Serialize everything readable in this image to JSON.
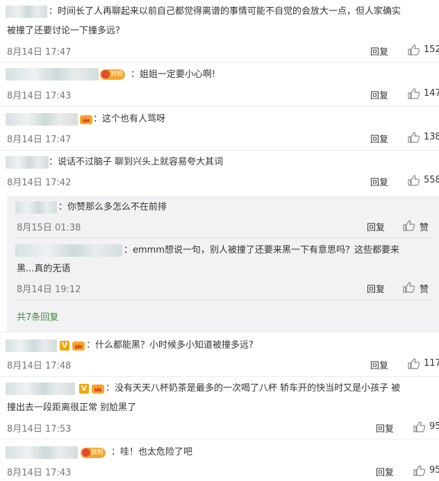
{
  "comments": [
    {
      "text": "：时间长了人再聊起来以前自己都觉得离谱的事情可能不自觉的会放大一点，但人家确实",
      "text2": "被撞了还要讨论一下撞多远?",
      "time": "8月14日 17:47",
      "reply": "回复",
      "likes": "152"
    },
    {
      "text": "：姐姐一定要小心啊!",
      "time": "8月14日 17:43",
      "reply": "回复",
      "likes": "147",
      "fan_badge": "铁粉"
    },
    {
      "text": "：这个也有人骂呀",
      "time": "8月14日 17:47",
      "reply": "回复",
      "likes": "138"
    },
    {
      "text": "：说话不过脑子 聊到兴头上就容易夸大其词",
      "time": "8月14日 17:42",
      "reply": "回复",
      "likes": "558"
    },
    {
      "text": "：什么都能黑？小时候多小知道被撞多远?",
      "time": "8月14日 17:48",
      "reply": "回复",
      "likes": "117"
    },
    {
      "text": "：没有天天八杯奶茶是最多的一次喝了八杯 轿车开的快当时又是小孩子 被",
      "text2": "撞出去一段距离很正常 别尬黑了",
      "time": "8月14日 17:53",
      "reply": "回复",
      "likes": "95"
    },
    {
      "text": "：哇！也太危险了吧",
      "time": "8月14日 17:43",
      "reply": "回复",
      "likes": "95",
      "fan_badge": "铁粉"
    }
  ],
  "sub_replies": [
    {
      "text": "：你赞那么多怎么不在前排",
      "time": "8月15日 01:38",
      "reply": "回复",
      "like_label": "赞"
    },
    {
      "text": "：emmm想说一句，别人被撞了还要来黑一下有意思吗？这些都要来",
      "text2": "黑...真的无语",
      "time": "8月14日 19:12",
      "reply": "回复",
      "like_label": "赞"
    }
  ],
  "more_replies": "共7条回复",
  "icons": {
    "like": "thumbs-up-icon",
    "verified": "v-badge-icon",
    "level": "level-crown-icon",
    "fan": "fan-heart-icon"
  },
  "colors": {
    "link_green": "#3d8a3d",
    "badge_orange": "#f7a529",
    "sub_bg": "#f2f2f5"
  }
}
